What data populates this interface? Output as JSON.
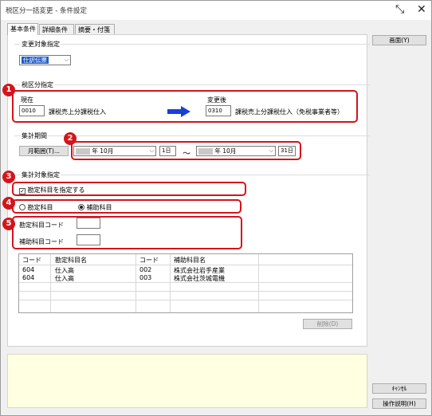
{
  "window": {
    "title": "税区分一括変更 - 条件設定"
  },
  "tabs": [
    "基本条件",
    "詳細条件",
    "摘要・付箋"
  ],
  "sections": {
    "target": "変更対象指定",
    "tax": "税区分指定",
    "period": "集計期間",
    "aggregate": "集計対象指定"
  },
  "target_combo": "仕訳伝票",
  "tax": {
    "current_label": "現在",
    "current_code": "0010",
    "current_name": "課税売上分課税仕入",
    "after_label": "変更後",
    "after_code": "0310",
    "after_name": "課税売上分課税仕入（免税事業者等）"
  },
  "period": {
    "button": "月範囲(T)...",
    "from_month": "年 10月",
    "from_day": "1日",
    "sep": "～",
    "to_month": "年 10月",
    "to_day": "31日"
  },
  "aggregate": {
    "check_label": "勘定科目を指定する",
    "radio_account": "勘定科目",
    "radio_sub": "補助科目",
    "code_account": "勘定科目コード",
    "code_sub": "補助科目コード"
  },
  "grid": {
    "headers": [
      "コード",
      "勘定科目名",
      "コード",
      "補助科目名"
    ],
    "rows": [
      [
        "604",
        "仕入高",
        "002",
        "株式会社岩手産業"
      ],
      [
        "604",
        "仕入高",
        "003",
        "株式会社茨城電機"
      ]
    ],
    "delete_button": "削除(D)"
  },
  "buttons": {
    "screen": "画面(Y)",
    "cancel": "ｷｬﾝｾﾙ",
    "help": "操作説明(H)"
  },
  "markers": [
    "1",
    "2",
    "3",
    "4",
    "5"
  ],
  "colors": {
    "highlight": "#d4141c",
    "selection": "#1e5bc6",
    "arrow": "#1a3fd6",
    "footer": "#ffffe1"
  }
}
